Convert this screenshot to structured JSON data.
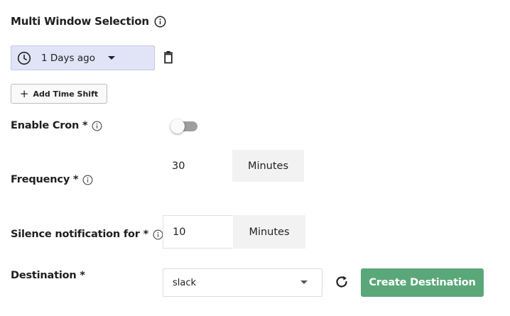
{
  "multi_window": {
    "title": "Multi Window Selection",
    "time_shift_value": "1 Days ago",
    "add_time_shift_label": "Add Time Shift"
  },
  "cron": {
    "label": "Enable Cron *",
    "enabled": false
  },
  "frequency": {
    "label": "Frequency *",
    "value": "30",
    "unit": "Minutes"
  },
  "silence": {
    "label": "Silence notification for *",
    "value": "10",
    "unit": "Minutes"
  },
  "destination": {
    "label": "Destination *",
    "selected": "slack",
    "create_label": "Create Destination"
  },
  "colors": {
    "accent_green": "#5aa77a",
    "time_select_bg": "#e1e3f7",
    "toggle_off": "#9e9e9e"
  },
  "icons": {
    "info": "info-icon",
    "clock": "clock-icon",
    "trash": "trash-icon",
    "plus": "plus-icon",
    "refresh": "refresh-icon",
    "caret": "chevron-down-icon"
  }
}
